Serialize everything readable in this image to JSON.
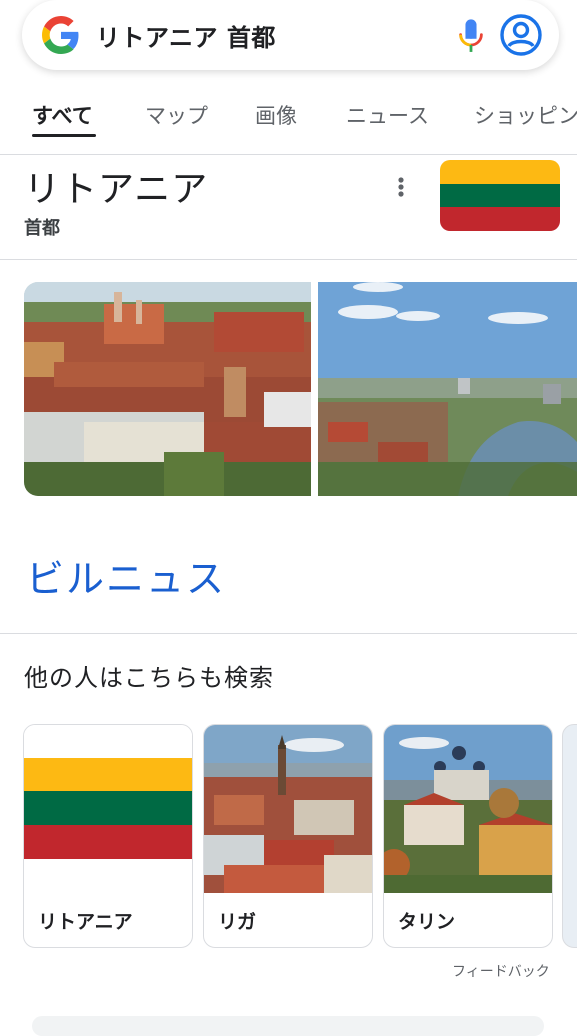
{
  "search": {
    "query": "リトアニア 首都"
  },
  "icons": {
    "google": "google-g-icon",
    "mic": "microphone-icon",
    "account": "account-icon",
    "more": "more-vert-icon"
  },
  "tabs": [
    {
      "label": "すべて",
      "active": true
    },
    {
      "label": "マップ"
    },
    {
      "label": "画像"
    },
    {
      "label": "ニュース"
    },
    {
      "label": "ショッピン"
    }
  ],
  "knowledge_panel": {
    "title": "リトアニア",
    "subtitle": "首都",
    "flag_colors": [
      "#fdb913",
      "#006a44",
      "#c1272d"
    ],
    "answer": "ビルニュス"
  },
  "people_also_search": {
    "title": "他の人はこちらも検索",
    "items": [
      {
        "label": "リトアニア"
      },
      {
        "label": "リガ"
      },
      {
        "label": "タリン"
      }
    ]
  },
  "feedback": "フィードバック",
  "colors": {
    "link_blue": "#1a5fd0",
    "divider": "#dadce0",
    "text": "#202124",
    "muted": "#5f6368"
  }
}
